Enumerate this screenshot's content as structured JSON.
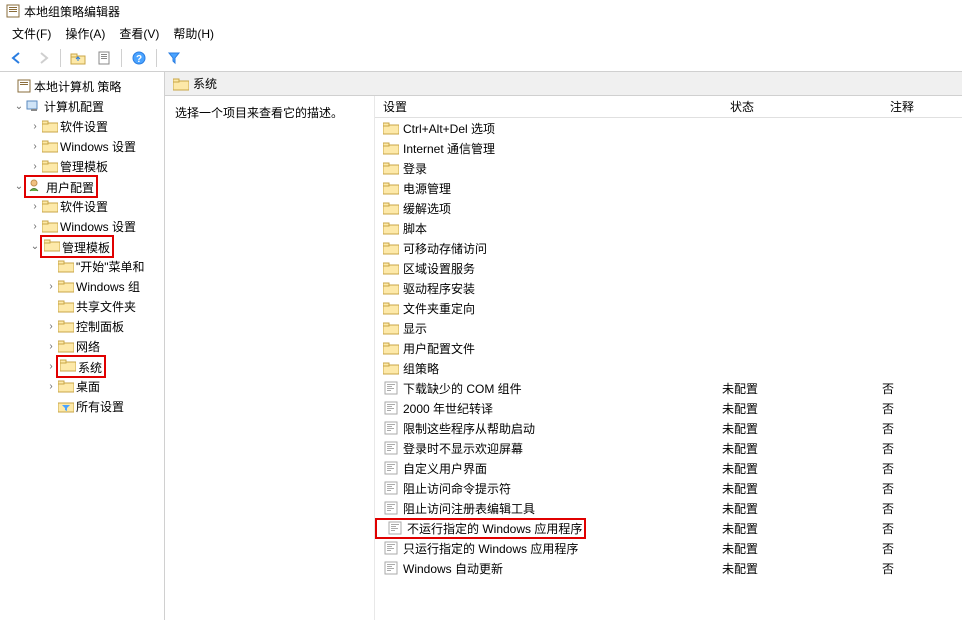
{
  "window": {
    "title": "本地组策略编辑器"
  },
  "menu": {
    "file": "文件(F)",
    "action": "操作(A)",
    "view": "查看(V)",
    "help": "帮助(H)"
  },
  "toolbar": {
    "back": "back-icon",
    "forward": "forward-icon",
    "up": "up-icon",
    "properties": "properties-icon",
    "help": "help-icon",
    "filter": "filter-icon"
  },
  "tree": [
    {
      "label": "本地计算机 策略",
      "indent": 0,
      "expander": "",
      "icon": "book",
      "red": false
    },
    {
      "label": "计算机配置",
      "indent": 1,
      "expander": "v",
      "icon": "pc",
      "red": false
    },
    {
      "label": "软件设置",
      "indent": 2,
      "expander": ">",
      "icon": "folder",
      "red": false
    },
    {
      "label": "Windows 设置",
      "indent": 2,
      "expander": ">",
      "icon": "folder",
      "red": false
    },
    {
      "label": "管理模板",
      "indent": 2,
      "expander": ">",
      "icon": "folder",
      "red": false
    },
    {
      "label": "用户配置",
      "indent": 1,
      "expander": "v",
      "icon": "user",
      "red": true
    },
    {
      "label": "软件设置",
      "indent": 2,
      "expander": ">",
      "icon": "folder",
      "red": false
    },
    {
      "label": "Windows 设置",
      "indent": 2,
      "expander": ">",
      "icon": "folder",
      "red": false
    },
    {
      "label": "管理模板",
      "indent": 2,
      "expander": "v",
      "icon": "folder",
      "red": true
    },
    {
      "label": "\"开始\"菜单和",
      "indent": 3,
      "expander": "",
      "icon": "folder",
      "red": false
    },
    {
      "label": "Windows 组",
      "indent": 3,
      "expander": ">",
      "icon": "folder",
      "red": false
    },
    {
      "label": "共享文件夹",
      "indent": 3,
      "expander": "",
      "icon": "folder",
      "red": false
    },
    {
      "label": "控制面板",
      "indent": 3,
      "expander": ">",
      "icon": "folder",
      "red": false
    },
    {
      "label": "网络",
      "indent": 3,
      "expander": ">",
      "icon": "folder",
      "red": false
    },
    {
      "label": "系统",
      "indent": 3,
      "expander": ">",
      "icon": "folder",
      "red": true
    },
    {
      "label": "桌面",
      "indent": 3,
      "expander": ">",
      "icon": "folder",
      "red": false
    },
    {
      "label": "所有设置",
      "indent": 3,
      "expander": "",
      "icon": "filter-folder",
      "red": false
    }
  ],
  "content": {
    "header": "系统",
    "description": "选择一个项目来查看它的描述。",
    "columns": {
      "name": "设置",
      "state": "状态",
      "note": "注释"
    },
    "rows": [
      {
        "label": "Ctrl+Alt+Del 选项",
        "icon": "folder",
        "state": "",
        "note": "",
        "red": false
      },
      {
        "label": "Internet 通信管理",
        "icon": "folder",
        "state": "",
        "note": "",
        "red": false
      },
      {
        "label": "登录",
        "icon": "folder",
        "state": "",
        "note": "",
        "red": false
      },
      {
        "label": "电源管理",
        "icon": "folder",
        "state": "",
        "note": "",
        "red": false
      },
      {
        "label": "缓解选项",
        "icon": "folder",
        "state": "",
        "note": "",
        "red": false
      },
      {
        "label": "脚本",
        "icon": "folder",
        "state": "",
        "note": "",
        "red": false
      },
      {
        "label": "可移动存储访问",
        "icon": "folder",
        "state": "",
        "note": "",
        "red": false
      },
      {
        "label": "区域设置服务",
        "icon": "folder",
        "state": "",
        "note": "",
        "red": false
      },
      {
        "label": "驱动程序安装",
        "icon": "folder",
        "state": "",
        "note": "",
        "red": false
      },
      {
        "label": "文件夹重定向",
        "icon": "folder",
        "state": "",
        "note": "",
        "red": false
      },
      {
        "label": "显示",
        "icon": "folder",
        "state": "",
        "note": "",
        "red": false
      },
      {
        "label": "用户配置文件",
        "icon": "folder",
        "state": "",
        "note": "",
        "red": false
      },
      {
        "label": "组策略",
        "icon": "folder",
        "state": "",
        "note": "",
        "red": false
      },
      {
        "label": "下载缺少的 COM 组件",
        "icon": "setting",
        "state": "未配置",
        "note": "否",
        "red": false
      },
      {
        "label": "2000 年世纪转译",
        "icon": "setting",
        "state": "未配置",
        "note": "否",
        "red": false
      },
      {
        "label": "限制这些程序从帮助启动",
        "icon": "setting",
        "state": "未配置",
        "note": "否",
        "red": false
      },
      {
        "label": "登录时不显示欢迎屏幕",
        "icon": "setting",
        "state": "未配置",
        "note": "否",
        "red": false
      },
      {
        "label": "自定义用户界面",
        "icon": "setting",
        "state": "未配置",
        "note": "否",
        "red": false
      },
      {
        "label": "阻止访问命令提示符",
        "icon": "setting",
        "state": "未配置",
        "note": "否",
        "red": false
      },
      {
        "label": "阻止访问注册表编辑工具",
        "icon": "setting",
        "state": "未配置",
        "note": "否",
        "red": false
      },
      {
        "label": "不运行指定的 Windows 应用程序",
        "icon": "setting",
        "state": "未配置",
        "note": "否",
        "red": true
      },
      {
        "label": "只运行指定的 Windows 应用程序",
        "icon": "setting",
        "state": "未配置",
        "note": "否",
        "red": false
      },
      {
        "label": "Windows 自动更新",
        "icon": "setting",
        "state": "未配置",
        "note": "否",
        "red": false
      }
    ]
  }
}
